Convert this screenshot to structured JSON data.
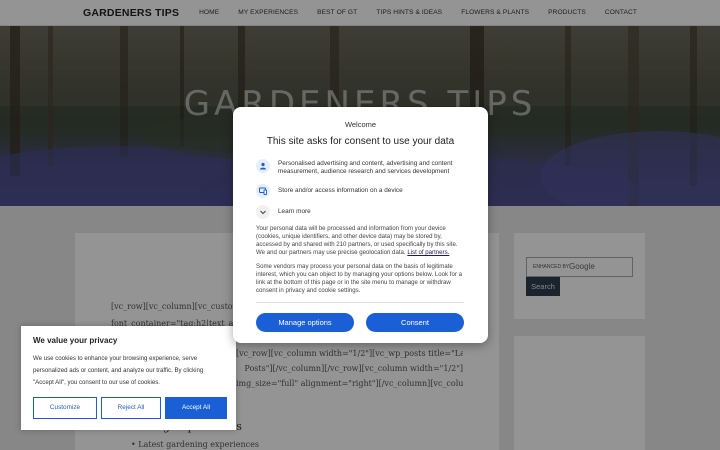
{
  "site": {
    "logo": "GARDENERS TIPS",
    "nav": [
      "HOME",
      "MY EXPERIENCES",
      "BEST OF GT",
      "TIPS HINTS & IDEAS",
      "FLOWERS & PLANTS",
      "PRODUCTS",
      "CONTACT"
    ]
  },
  "hero": {
    "title": "GARDENERS TIPS",
    "subtitle": "Tips"
  },
  "content": {
    "code_lines": [
      "[vc_row][vc_column][vc_custom",
      "font_container=\"tag:h2|text_alig",
      "[vc_row][vc_column width=\"1/2\"][vc_wp_posts title=\"Latest Blog",
      "Posts\"][/vc_column][/vc_row][vc_column width=\"1/2\"]",
      "img_size=\"full\" alignment=\"right\"][/vc_column][vc_column"
    ],
    "heading": "Gardening Experiences",
    "bullet": "Latest gardening experiences"
  },
  "sidebar": {
    "search_enhanced": "ENHANCED BY",
    "search_brand": "Google",
    "search_button": "Search"
  },
  "consent": {
    "welcome": "Welcome",
    "title": "This site asks for consent to use your data",
    "purposes": [
      "Personalised advertising and content, advertising and content measurement, audience research and services development",
      "Store and/or access information on a device",
      "Learn more"
    ],
    "body1": "Your personal data will be processed and information from your device (cookies, unique identifiers, and other device data) may be stored by, accessed by and shared with 210 partners, or used specifically by this site. We and our partners may use precise geolocation data.",
    "partners_link": "List of partners.",
    "body2": "Some vendors may process your personal data on the basis of legitimate interest, which you can object to by managing your options below. Look for a link at the bottom of this page or in the site menu to manage or withdraw consent in privacy and cookie settings.",
    "manage_button": "Manage options",
    "consent_button": "Consent"
  },
  "cookie": {
    "title": "We value your privacy",
    "text": "We use cookies to enhance your browsing experience, serve personalized ads or content, and analyze our traffic. By clicking \"Accept All\", you consent to our use of cookies.",
    "customize": "Customize",
    "reject": "Reject All",
    "accept": "Accept All"
  },
  "colors": {
    "accent": "#1a5fd6",
    "search_button": "#2c3e50"
  },
  "icons": [
    "personalised-ads-icon",
    "device-storage-icon",
    "chevron-down-icon"
  ]
}
